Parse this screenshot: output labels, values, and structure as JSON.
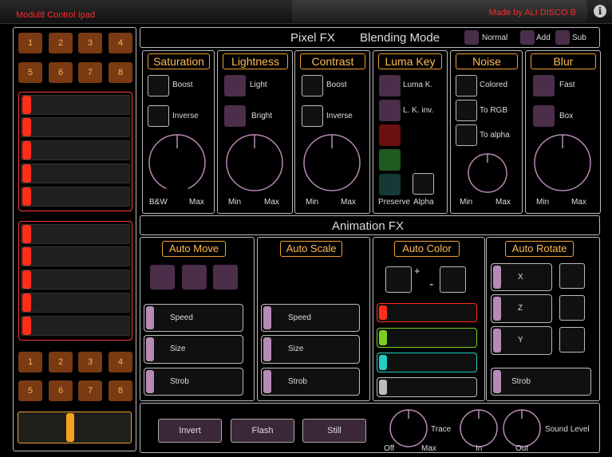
{
  "topbar": {
    "title": "Modul8 Control Ipad",
    "credit": "Made by ALI DISCO B",
    "info_glyph": "i"
  },
  "left": {
    "top_numbers": [
      "1",
      "2",
      "3",
      "4",
      "5",
      "6",
      "7",
      "8"
    ],
    "bottom_numbers": [
      "1",
      "2",
      "3",
      "4",
      "5",
      "6",
      "7",
      "8"
    ],
    "crossfader_value": 0.46
  },
  "pixel_fx": {
    "title": "Pixel FX",
    "blending_title": "Blending Mode",
    "blend_modes": [
      "Normal",
      "Add",
      "Sub"
    ],
    "saturation": {
      "title": "Saturation",
      "opt1": "Boost",
      "opt2": "Inverse",
      "min": "B&W",
      "max": "Max"
    },
    "lightness": {
      "title": "Lightness",
      "opt1": "Light",
      "opt2": "Bright",
      "min": "Min",
      "max": "Max"
    },
    "contrast": {
      "title": "Contrast",
      "opt1": "Boost",
      "opt2": "Inverse",
      "min": "Min",
      "max": "Max"
    },
    "luma_key": {
      "title": "Luma Key",
      "opt1": "Luma K.",
      "opt2": "L. K. inv.",
      "preserve": "Preserve",
      "alpha": "Alpha"
    },
    "noise": {
      "title": "Noise",
      "opt1": "Colored",
      "opt2": "To RGB",
      "opt3": "To alpha",
      "min": "Min",
      "max": "Max"
    },
    "blur": {
      "title": "Blur",
      "opt1": "Fast",
      "opt2": "Box",
      "min": "Min",
      "max": "Max"
    }
  },
  "animation_fx": {
    "title": "Animation FX",
    "auto_move": {
      "title": "Auto Move",
      "speed": "Speed",
      "size": "Size",
      "strob": "Strob"
    },
    "auto_scale": {
      "title": "Auto Scale",
      "speed": "Speed",
      "size": "Size",
      "strob": "Strob"
    },
    "auto_color": {
      "title": "Auto Color",
      "plus": "+",
      "minus": "-",
      "colors": [
        "#ff2d1a",
        "#7ad020",
        "#20d0c0",
        "#bbbbbb"
      ]
    },
    "auto_rotate": {
      "title": "Auto Rotate",
      "x": "X",
      "z": "Z",
      "y": "Y",
      "strob": "Strob"
    }
  },
  "bottom": {
    "invert": "Invert",
    "flash": "Flash",
    "still": "Still",
    "trace": "Trace",
    "off": "Off",
    "max": "Max",
    "sound_level": "Sound Level",
    "in": "In",
    "out": "Out"
  }
}
